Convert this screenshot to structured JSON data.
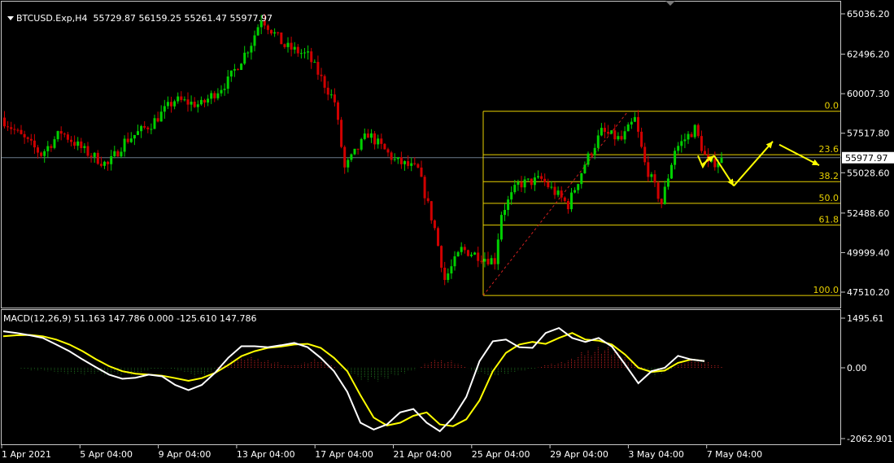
{
  "header": {
    "symbol": "BTCUSD.Exp,H4",
    "ohlc": "55729.87 56159.25 55261.47 55977.97"
  },
  "macd_header": "MACD(12,26,9) 51.163 147.786 0.000 -125.610 147.786",
  "colors": {
    "background": "#000000",
    "bull": "#00d000",
    "bear": "#d00000",
    "fib": "#e8d000",
    "arrow": "#ffff00",
    "macd_main": "#ffffff",
    "macd_signal": "#ffff00",
    "hist_up": "#c02020",
    "hist_down": "#1f6f1f",
    "current_price_line": "#6a7a8a",
    "price_tag_bg": "#ffffff",
    "price_tag_text": "#000000"
  },
  "chart_data": [
    {
      "type": "candlestick",
      "symbol": "BTCUSD.Exp",
      "timeframe": "H4",
      "price_axis_ticks": [
        "65036.20",
        "62496.20",
        "60007.30",
        "57517.80",
        "55028.60",
        "52488.60",
        "49999.40",
        "47510.20"
      ],
      "price_axis_values": [
        65036.2,
        62496.2,
        60007.3,
        57517.8,
        55028.6,
        52488.6,
        49999.4,
        47510.2
      ],
      "time_axis_ticks": [
        "1 Apr 2021",
        "5 Apr 04:00",
        "9 Apr 04:00",
        "13 Apr 04:00",
        "17 Apr 04:00",
        "21 Apr 04:00",
        "25 Apr 04:00",
        "29 Apr 04:00",
        "3 May 04:00",
        "7 May 04:00"
      ],
      "current_price": "55977.97",
      "current_price_value": 55977.97,
      "price_keypoints": [
        [
          0,
          58500
        ],
        [
          5,
          57500
        ],
        [
          12,
          56200
        ],
        [
          18,
          57600
        ],
        [
          25,
          56400
        ],
        [
          32,
          55500
        ],
        [
          37,
          57000
        ],
        [
          45,
          58100
        ],
        [
          52,
          59600
        ],
        [
          60,
          59300
        ],
        [
          68,
          60800
        ],
        [
          75,
          63200
        ],
        [
          78,
          64800
        ],
        [
          85,
          63000
        ],
        [
          92,
          62400
        ],
        [
          100,
          59500
        ],
        [
          103,
          55300
        ],
        [
          110,
          57500
        ],
        [
          118,
          55800
        ],
        [
          125,
          55200
        ],
        [
          130,
          51500
        ],
        [
          133,
          48300
        ],
        [
          138,
          50200
        ],
        [
          146,
          49600
        ],
        [
          148,
          49500
        ],
        [
          150,
          52500
        ],
        [
          155,
          54300
        ],
        [
          162,
          54600
        ],
        [
          170,
          53000
        ],
        [
          175,
          55600
        ],
        [
          180,
          57600
        ],
        [
          186,
          57100
        ],
        [
          190,
          58400
        ],
        [
          193,
          55600
        ],
        [
          198,
          53100
        ],
        [
          202,
          56500
        ],
        [
          208,
          57800
        ],
        [
          212,
          55500
        ],
        [
          215,
          55800
        ]
      ],
      "fibonacci": {
        "levels": [
          "0.0",
          "23.6",
          "38.2",
          "50.0",
          "61.8",
          "100.0"
        ],
        "high_price": 58900,
        "low_price": 47300
      },
      "forecast_path_prices": [
        55500,
        56100,
        54200,
        57000,
        56800,
        55500
      ]
    },
    {
      "type": "macd",
      "title": "MACD(12,26,9)",
      "axis_ticks": [
        "1495.61",
        "0.00",
        "-2062.901"
      ],
      "axis_values": [
        1495.61,
        0,
        -2062.901
      ],
      "main_values": [
        1100,
        1050,
        980,
        900,
        700,
        500,
        250,
        20,
        -200,
        -320,
        -290,
        -200,
        -250,
        -500,
        -650,
        -500,
        -150,
        300,
        650,
        650,
        620,
        680,
        750,
        620,
        300,
        -100,
        -700,
        -1600,
        -1800,
        -1650,
        -1300,
        -1200,
        -1600,
        -1850,
        -1450,
        -850,
        200,
        800,
        850,
        620,
        600,
        1050,
        1200,
        900,
        780,
        900,
        640,
        100,
        -450,
        -100,
        0,
        360,
        250,
        200
      ],
      "signal_values": [
        950,
        980,
        990,
        950,
        850,
        700,
        500,
        260,
        50,
        -100,
        -170,
        -200,
        -230,
        -300,
        -380,
        -300,
        -150,
        80,
        350,
        500,
        600,
        640,
        700,
        720,
        600,
        300,
        -100,
        -800,
        -1450,
        -1680,
        -1600,
        -1400,
        -1300,
        -1650,
        -1700,
        -1500,
        -950,
        -100,
        450,
        700,
        780,
        720,
        900,
        1050,
        850,
        820,
        700,
        400,
        0,
        -120,
        -80,
        150,
        250,
        200
      ],
      "histogram": [
        0,
        0,
        -60,
        -80,
        -130,
        -170,
        -180,
        -140,
        -200,
        -210,
        -120,
        -60,
        0,
        -90,
        -220,
        -180,
        80,
        220,
        290,
        240,
        160,
        60,
        120,
        230,
        120,
        -60,
        -220,
        -380,
        -320,
        -180,
        -120,
        90,
        230,
        190,
        50,
        -150,
        -230,
        -160,
        -90,
        -40,
        80,
        150,
        250,
        470,
        580,
        480,
        260,
        40,
        -200,
        -120,
        130,
        220,
        150,
        50
      ]
    }
  ]
}
